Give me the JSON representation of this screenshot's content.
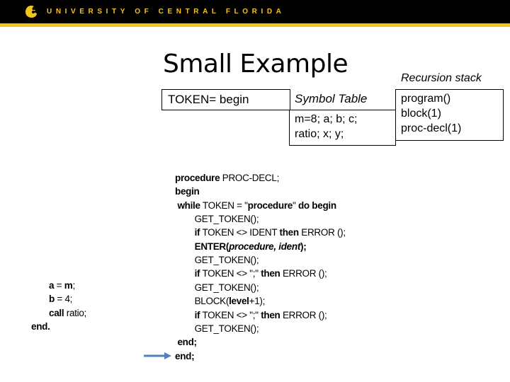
{
  "header": {
    "university_name": "UNIVERSITY OF CENTRAL FLORIDA",
    "logo_icon": "pegasus-logo-icon",
    "colors": {
      "bar": "#000000",
      "accent": "#f2c51c"
    }
  },
  "slide": {
    "title": "Small Example",
    "token_box": {
      "text": "TOKEN= begin"
    },
    "symbol_table": {
      "label": "Symbol Table",
      "lines": [
        "m=8; a; b; c;",
        "ratio; x; y;"
      ]
    },
    "recursion_stack": {
      "label": "Recursion stack",
      "items": [
        "program()",
        "block(1)",
        "proc-decl(1)"
      ]
    },
    "main_code": [
      [
        {
          "t": "a",
          "b": true
        },
        {
          "t": " = "
        },
        {
          "t": "m",
          "b": true
        },
        {
          "t": ";"
        }
      ],
      [
        {
          "t": "b",
          "b": true
        },
        {
          "t": " = 4;"
        }
      ],
      [
        {
          "t": "call",
          "b": true
        },
        {
          "t": " ratio;"
        }
      ],
      [
        {
          "t": "end.",
          "b": true
        }
      ]
    ],
    "proc_code": [
      [
        {
          "t": "procedure",
          "b": true
        },
        {
          "t": " PROC-DECL;"
        }
      ],
      [
        {
          "t": "begin",
          "b": true
        }
      ],
      [
        {
          "t": " "
        },
        {
          "t": "while",
          "b": true
        },
        {
          "t": " TOKEN = \""
        },
        {
          "t": "procedure",
          "b": true
        },
        {
          "t": "\" "
        },
        {
          "t": "do begin",
          "b": true
        }
      ],
      [
        {
          "t": "        GET_TOKEN();"
        }
      ],
      [
        {
          "t": "        "
        },
        {
          "t": "if",
          "b": true
        },
        {
          "t": " TOKEN <> IDENT "
        },
        {
          "t": "then",
          "b": true
        },
        {
          "t": " ERROR ();"
        }
      ],
      [
        {
          "t": "        "
        },
        {
          "t": "ENTER(",
          "b": true
        },
        {
          "t": "procedure, ident",
          "b": true,
          "i": true
        },
        {
          "t": ");",
          "b": true
        }
      ],
      [
        {
          "t": "        GET_TOKEN();"
        }
      ],
      [
        {
          "t": "        "
        },
        {
          "t": "if",
          "b": true
        },
        {
          "t": " TOKEN <> \";\" "
        },
        {
          "t": "then",
          "b": true
        },
        {
          "t": " ERROR ();"
        }
      ],
      [
        {
          "t": "        GET_TOKEN();"
        }
      ],
      [
        {
          "t": "        BLOCK("
        },
        {
          "t": "level",
          "b": true
        },
        {
          "t": "+1);"
        }
      ],
      [
        {
          "t": "        "
        },
        {
          "t": "if",
          "b": true
        },
        {
          "t": " TOKEN <> \";\" "
        },
        {
          "t": "then",
          "b": true
        },
        {
          "t": " ERROR ();"
        }
      ],
      [
        {
          "t": "        GET_TOKEN();"
        }
      ],
      [
        {
          "t": " "
        },
        {
          "t": "end;",
          "b": true
        }
      ],
      [
        {
          "t": "end;",
          "b": true
        }
      ]
    ],
    "current_line_arrow": {
      "icon": "right-arrow-icon",
      "color": "#4f81bd",
      "points_to_line": "end;"
    }
  }
}
